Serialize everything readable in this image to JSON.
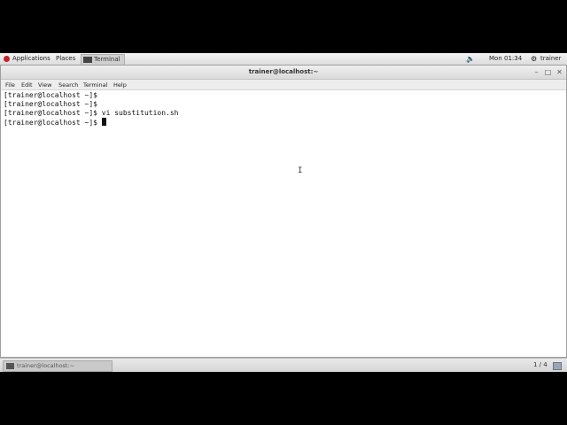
{
  "topbar": {
    "applications_label": "Applications",
    "places_label": "Places",
    "task_label": "Terminal",
    "clock": "Mon 01:34",
    "user_label": "trainer"
  },
  "window": {
    "title": "trainer@localhost:~",
    "menu": [
      "File",
      "Edit",
      "View",
      "Search",
      "Terminal",
      "Help"
    ]
  },
  "terminal": {
    "lines": [
      "[trainer@localhost ~]$",
      "[trainer@localhost ~]$",
      "[trainer@localhost ~]$ vi substitution.sh",
      "[trainer@localhost ~]$ "
    ]
  },
  "bottombar": {
    "task_label": "trainer@localhost:~",
    "workspace": "1 / 4"
  }
}
